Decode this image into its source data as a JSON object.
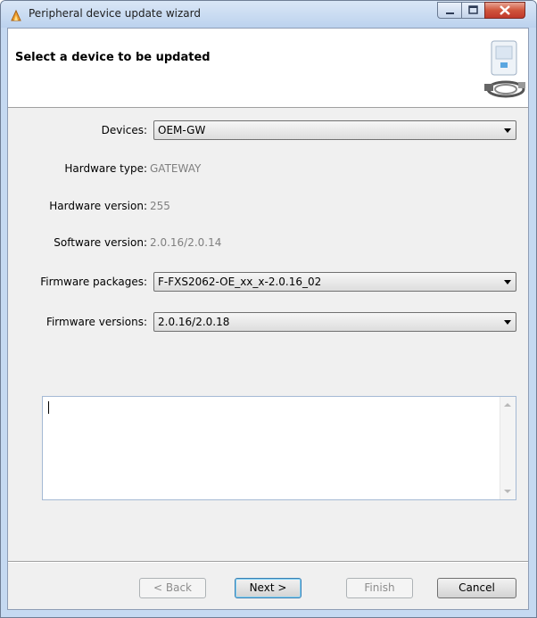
{
  "window": {
    "title": "Peripheral device update wizard",
    "icon": "wizard-app-icon"
  },
  "header": {
    "title": "Select a device to be updated",
    "art_icon": "device-update-illustration-icon"
  },
  "form": {
    "devices": {
      "label": "Devices:",
      "value": "OEM-GW"
    },
    "hardware_type": {
      "label": "Hardware type:",
      "value": "GATEWAY"
    },
    "hardware_version": {
      "label": "Hardware version:",
      "value": "255"
    },
    "software_version": {
      "label": "Software version:",
      "value": "2.0.16/2.0.14"
    },
    "firmware_packages": {
      "label": "Firmware packages:",
      "value": "F-FXS2062-OE_xx_x-2.0.16_02"
    },
    "firmware_versions": {
      "label": "Firmware versions:",
      "value": "2.0.16/2.0.18"
    }
  },
  "log": {
    "text": ""
  },
  "buttons": {
    "back": "< Back",
    "next": "Next >",
    "finish": "Finish",
    "cancel": "Cancel"
  },
  "colors": {
    "titlebar": "#c5d9f1",
    "close_button": "#c0392b",
    "dialog_bg": "#f0f0f0",
    "disabled_text": "#7f7f7f"
  }
}
